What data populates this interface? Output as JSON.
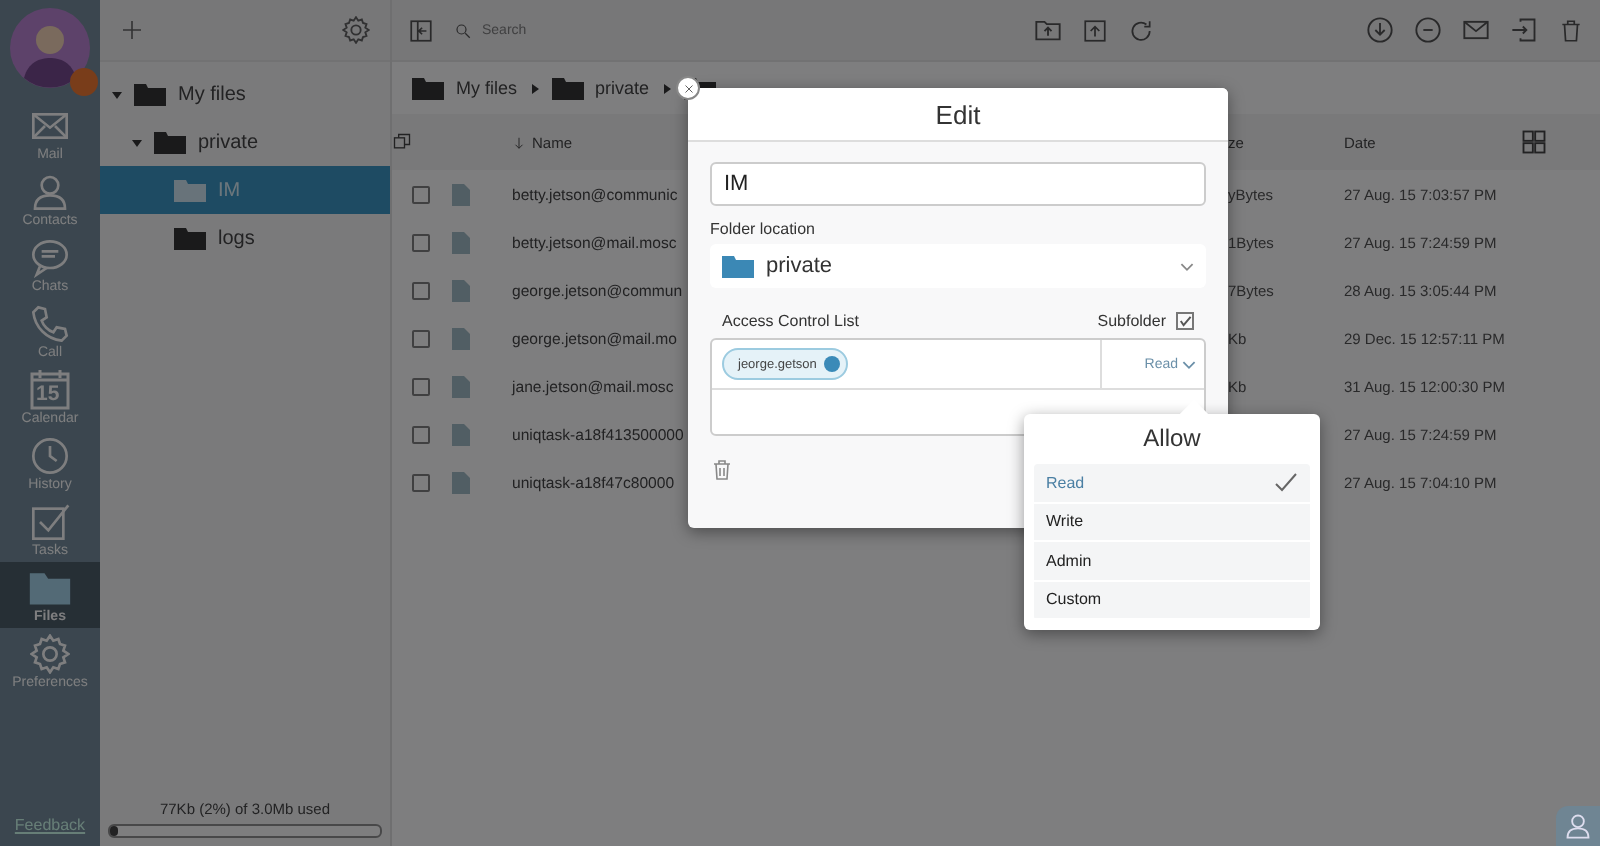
{
  "nav": {
    "items": [
      {
        "label": "Mail",
        "selected": false
      },
      {
        "label": "Contacts",
        "selected": false
      },
      {
        "label": "Chats",
        "selected": false
      },
      {
        "label": "Call",
        "selected": false
      },
      {
        "label": "Calendar",
        "calendar_day": "15",
        "selected": false
      },
      {
        "label": "History",
        "selected": false
      },
      {
        "label": "Tasks",
        "selected": false
      },
      {
        "label": "Files",
        "selected": true
      },
      {
        "label": "Preferences",
        "selected": false
      }
    ],
    "feedback": "Feedback"
  },
  "folders": {
    "tree": [
      {
        "label": "My files",
        "expanded": true,
        "selected": false,
        "children": [
          {
            "label": "private",
            "expanded": true,
            "selected": false,
            "children": [
              {
                "label": "IM",
                "selected": true
              },
              {
                "label": "logs",
                "selected": false
              }
            ]
          }
        ]
      }
    ],
    "storage": {
      "text": "77Kb (2%) of 3.0Mb used",
      "level": 0.02
    }
  },
  "toolbar": {
    "search": {
      "placeholder": "Search"
    }
  },
  "breadcrumb": [
    "My files",
    "private"
  ],
  "table": {
    "columns": [
      "Name",
      "ze",
      "Date"
    ],
    "rows": [
      {
        "name": "betty.jetson@communic",
        "size": "yBytes",
        "date": "27 Aug. 15 7:03:57 PM",
        "checked": false
      },
      {
        "name": "betty.jetson@mail.mosc",
        "size": "1Bytes",
        "date": "27 Aug. 15 7:24:59 PM",
        "checked": false
      },
      {
        "name": "george.jetson@commun",
        "size": "7Bytes",
        "date": "28 Aug. 15 3:05:44 PM",
        "checked": false
      },
      {
        "name": "george.jetson@mail.mo",
        "size": "Kb",
        "date": "29 Dec. 15 12:57:11 PM",
        "checked": false
      },
      {
        "name": "jane.jetson@mail.mosc",
        "size": "Kb",
        "date": "31 Aug. 15 12:00:30 PM",
        "checked": false
      },
      {
        "name": "uniqtask-a18f413500000",
        "date": "27 Aug. 15 7:24:59 PM",
        "checked": false
      },
      {
        "name": "uniqtask-a18f47c80000",
        "date": "27 Aug. 15 7:04:10 PM",
        "checked": false
      }
    ]
  },
  "dialog": {
    "title": "Edit",
    "name_value": "IM",
    "location_label": "Folder location",
    "location_value": "private",
    "acl_label": "Access Control List",
    "subfolder": {
      "label": "Subfolder",
      "checked": true
    },
    "acl_entries": [
      {
        "user": "jeorge.getson",
        "permission": "Read"
      }
    ]
  },
  "popover": {
    "title": "Allow",
    "options": [
      {
        "label": "Read",
        "selected": true
      },
      {
        "label": "Write",
        "selected": false
      },
      {
        "label": "Admin",
        "selected": false
      },
      {
        "label": "Custom",
        "selected": false
      }
    ]
  }
}
